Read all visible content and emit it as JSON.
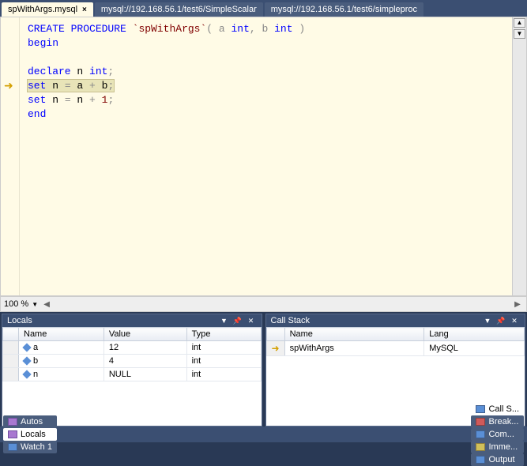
{
  "tabs": [
    {
      "label": "spWithArgs.mysql",
      "active": true
    },
    {
      "label": "mysql://192.168.56.1/test6/SimpleScalar",
      "active": false
    },
    {
      "label": "mysql://192.168.56.1/test6/simpleproc",
      "active": false
    }
  ],
  "editor": {
    "current_line_index": 3,
    "tokens": [
      [
        {
          "t": "CREATE",
          "c": "kw-blue"
        },
        {
          "t": " "
        },
        {
          "t": "PROCEDURE",
          "c": "kw-blue"
        },
        {
          "t": " "
        },
        {
          "t": "`spWithArgs`",
          "c": "kw-red"
        },
        {
          "t": "( a ",
          "c": "op-gray"
        },
        {
          "t": "int",
          "c": "kw-blue"
        },
        {
          "t": ", b ",
          "c": "op-gray"
        },
        {
          "t": "int",
          "c": "kw-blue"
        },
        {
          "t": " )",
          "c": "op-gray"
        }
      ],
      [
        {
          "t": "begin",
          "c": "kw-blue"
        }
      ],
      [],
      [
        {
          "t": "declare",
          "c": "kw-blue"
        },
        {
          "t": " n "
        },
        {
          "t": "int",
          "c": "kw-blue"
        },
        {
          "t": ";",
          "c": "op-gray"
        }
      ],
      [
        {
          "t": "set",
          "c": "kw-blue"
        },
        {
          "t": " n "
        },
        {
          "t": "=",
          "c": "op-gray"
        },
        {
          "t": " a "
        },
        {
          "t": "+",
          "c": "op-gray"
        },
        {
          "t": " b"
        },
        {
          "t": ";",
          "c": "op-gray"
        }
      ],
      [
        {
          "t": "set",
          "c": "kw-blue"
        },
        {
          "t": " n "
        },
        {
          "t": "=",
          "c": "op-gray"
        },
        {
          "t": " n "
        },
        {
          "t": "+",
          "c": "op-gray"
        },
        {
          "t": " "
        },
        {
          "t": "1",
          "c": "kw-red"
        },
        {
          "t": ";",
          "c": "op-gray"
        }
      ],
      [
        {
          "t": "end",
          "c": "kw-blue"
        }
      ]
    ]
  },
  "zoom": "100 %",
  "locals": {
    "title": "Locals",
    "columns": [
      "Name",
      "Value",
      "Type"
    ],
    "rows": [
      {
        "name": "a",
        "value": "12",
        "type": "int"
      },
      {
        "name": "b",
        "value": "4",
        "type": "int"
      },
      {
        "name": "n",
        "value": "NULL",
        "type": "int"
      }
    ]
  },
  "callstack": {
    "title": "Call Stack",
    "columns": [
      "Name",
      "Lang"
    ],
    "rows": [
      {
        "name": "spWithArgs",
        "lang": "MySQL",
        "current": true
      }
    ]
  },
  "status_left": [
    {
      "label": "Autos",
      "icon": "ic-purple"
    },
    {
      "label": "Locals",
      "icon": "ic-purple",
      "active": true
    },
    {
      "label": "Watch 1",
      "icon": "ic-blue"
    }
  ],
  "status_right": [
    {
      "label": "Call S...",
      "icon": "ic-blue",
      "active": true
    },
    {
      "label": "Break...",
      "icon": "ic-red"
    },
    {
      "label": "Com...",
      "icon": "ic-blue"
    },
    {
      "label": "Imme...",
      "icon": "ic-yellow"
    },
    {
      "label": "Output",
      "icon": "ic-blue"
    }
  ]
}
